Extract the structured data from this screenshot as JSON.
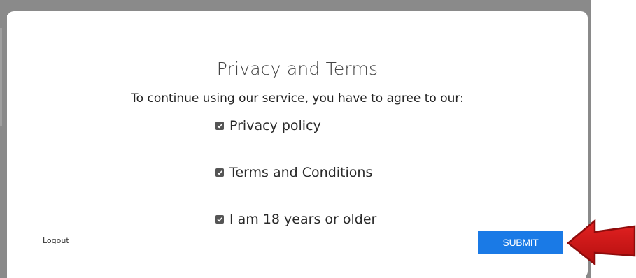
{
  "dialog": {
    "title": "Privacy and Terms",
    "subtitle": "To continue using our service, you have to agree to our:",
    "checkboxes": [
      {
        "label": "Privacy policy",
        "checked": true
      },
      {
        "label": "Terms and Conditions",
        "checked": true
      },
      {
        "label": "I am 18 years or older",
        "checked": true
      }
    ],
    "logout_label": "Logout",
    "submit_label": "SUBMIT"
  },
  "colors": {
    "submit_bg": "#1a7ae6",
    "arrow": "#d01818",
    "backdrop": "#8a8a8a"
  },
  "icons": {
    "checkbox": "checkbox-checked-icon",
    "annotation": "red-arrow-icon"
  }
}
